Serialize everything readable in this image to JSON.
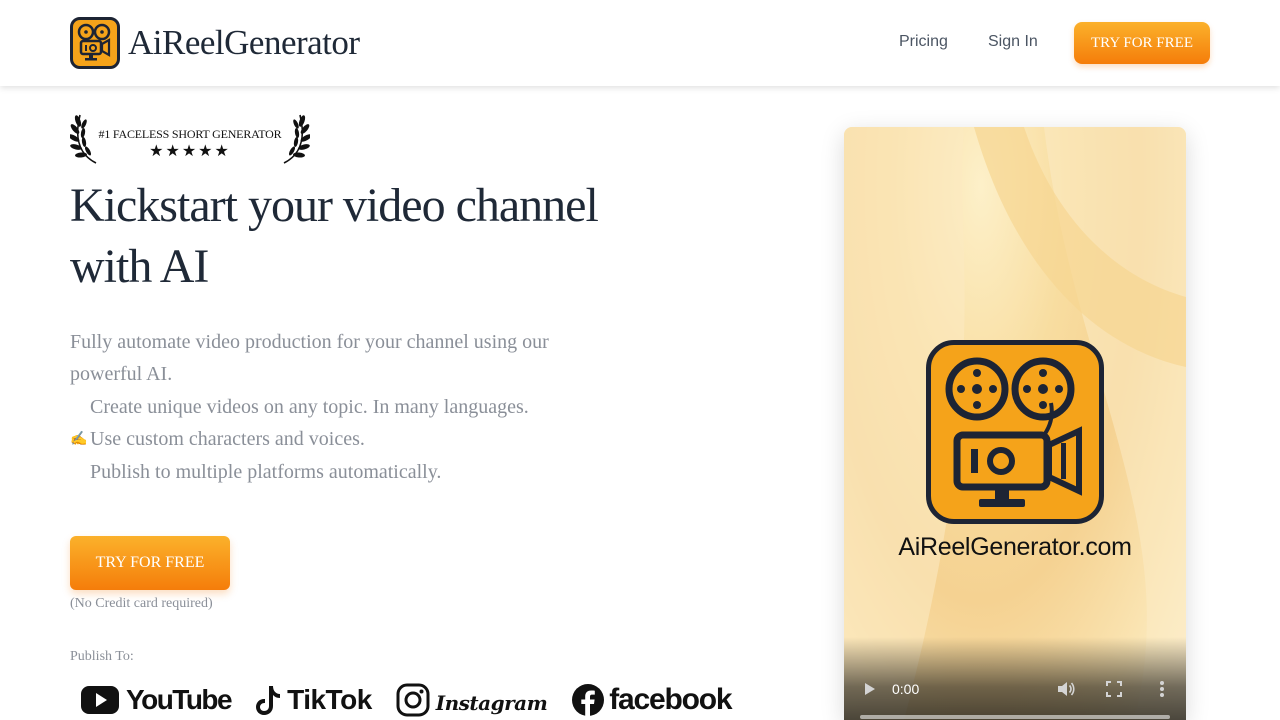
{
  "header": {
    "brand_name": "AiReelGenerator",
    "nav": {
      "pricing": "Pricing",
      "sign_in": "Sign In"
    },
    "cta_label": "TRY FOR FREE"
  },
  "award": {
    "text": "#1 FACELESS SHORT GENERATOR",
    "stars": "★★★★★"
  },
  "hero": {
    "title": "Kickstart your video channel with AI",
    "description": "Fully automate video production for your channel using our powerful AI.",
    "features": [
      {
        "icon": "",
        "text": "Create unique videos on any topic. In many languages."
      },
      {
        "icon": "✍",
        "text": "Use custom characters and voices."
      },
      {
        "icon": "",
        "text": "Publish to multiple platforms automatically."
      }
    ],
    "cta_label": "TRY FOR FREE",
    "cta_note": "(No Credit card required)",
    "publish_label": "Publish To:"
  },
  "platforms": [
    {
      "name": "YouTube",
      "icon": "youtube-icon"
    },
    {
      "name": "TikTok",
      "icon": "tiktok-icon"
    },
    {
      "name": "Instagram",
      "icon": "instagram-icon"
    },
    {
      "name": "facebook",
      "icon": "facebook-icon"
    }
  ],
  "video": {
    "caption": "AiReelGenerator.com",
    "time": "0:00"
  },
  "colors": {
    "accent_start": "#fbb12b",
    "accent_end": "#f57d0a",
    "logo_orange": "#f5a31a",
    "logo_dark": "#1d2434"
  }
}
